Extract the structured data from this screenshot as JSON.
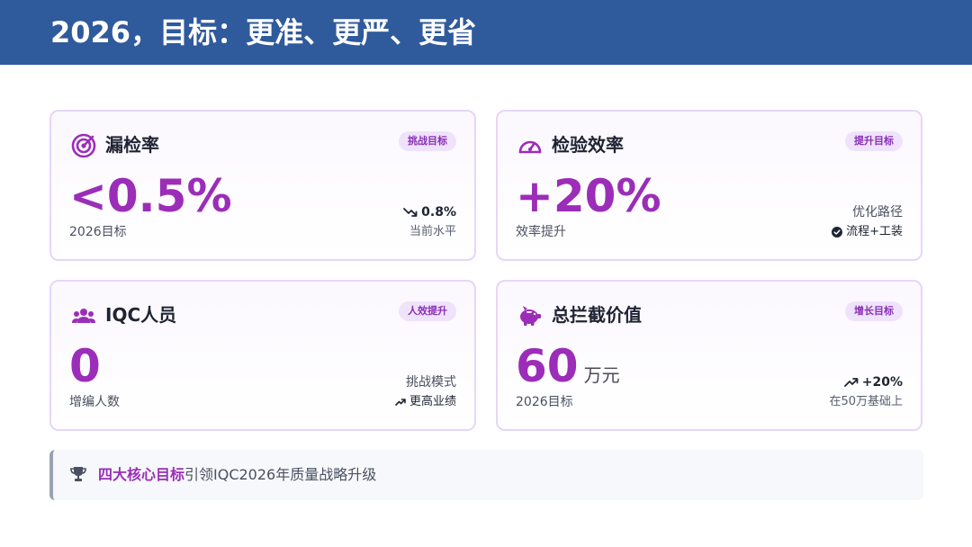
{
  "header": {
    "title": "2026，目标：更准、更严、更省",
    "background_color": "#2f5a9c"
  },
  "accent_color": "#9b2db8",
  "cards": [
    {
      "icon": "target-icon",
      "title": "漏检率",
      "badge": "挑战目标",
      "value": "<0.5%",
      "unit": "",
      "sub": "2026目标",
      "right_top": "0.8%",
      "right_top_icon": "trend-down-icon",
      "right_bottom": "当前水平"
    },
    {
      "icon": "gauge-icon",
      "title": "检验效率",
      "badge": "提升目标",
      "value": "+20%",
      "unit": "",
      "sub": "效率提升",
      "right_top": "优化路径",
      "right_bottom": "流程+工装",
      "right_bottom_icon": "check-circle-icon"
    },
    {
      "icon": "users-icon",
      "title": "IQC人员",
      "badge": "人效提升",
      "value": "0",
      "unit": "",
      "sub": "增编人数",
      "right_top": "挑战模式",
      "right_bottom": "更高业绩",
      "right_bottom_icon": "trend-up-icon"
    },
    {
      "icon": "piggy-bank-icon",
      "title": "总拦截价值",
      "badge": "增长目标",
      "value": "60",
      "unit": "万元",
      "sub": "2026目标",
      "right_top": "+20%",
      "right_top_icon": "trend-up-icon",
      "right_bottom": "在50万基础上"
    }
  ],
  "footer": {
    "icon": "trophy-icon",
    "highlight": "四大核心目标",
    "text": "引领IQC2026年质量战略升级"
  }
}
